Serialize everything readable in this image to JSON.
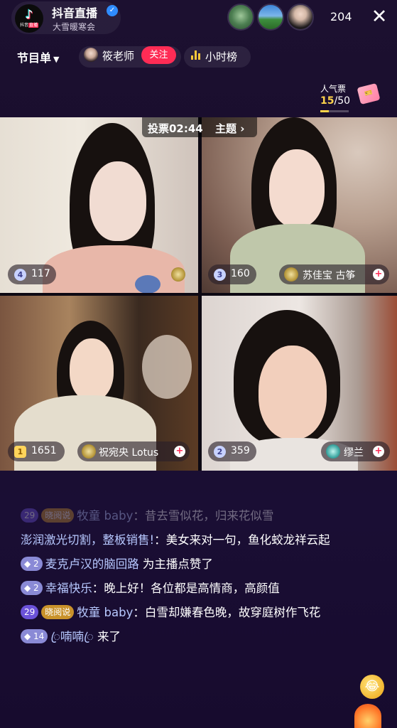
{
  "header": {
    "logo_text": "抖音",
    "logo_tag": "直播",
    "title": "抖音直播",
    "subtitle": "大雪暖寒会",
    "viewer_count": "204",
    "close_symbol": "✕"
  },
  "toolbar": {
    "program_label": "节目单",
    "teacher_name": "筱老师",
    "follow_label": "关注",
    "hourly_rank_label": "小时榜"
  },
  "popularity": {
    "label": "人气票",
    "current": "15",
    "total": "/50",
    "fraction": 0.3
  },
  "vote": {
    "timer": "投票02:44",
    "topic": "主题 ›"
  },
  "streams": [
    {
      "rank": "4",
      "score": "117",
      "name": ""
    },
    {
      "rank": "3",
      "score": "160",
      "name": "苏佳宝 古筝"
    },
    {
      "rank": "1",
      "score": "1651",
      "name": "祝宛央 Lotus"
    },
    {
      "rank": "2",
      "score": "359",
      "name": "缪兰"
    }
  ],
  "chat": [
    {
      "level": "29",
      "fan": "晓阅说",
      "user": "牧童 baby",
      "text": "：昔去雪似花，归来花似雪",
      "faded": true
    },
    {
      "user": "澎润激光切割，整板销售!",
      "text": "：美女来对一句，鱼化蛟龙祥云起"
    },
    {
      "level": "2",
      "user": "麦克卢汉的脑回路",
      "text": " 为主播点赞了"
    },
    {
      "level": "2",
      "user": "幸福快乐",
      "text": "：晚上好！各位都是高情商，高颜值"
    },
    {
      "level": "29",
      "fan": "晓阅说",
      "user": "牧童 baby",
      "text": "：白雪却嫌春色晚，故穿庭树作飞花"
    },
    {
      "level": "14",
      "user": "ꦿ喃喃ꦿ",
      "text": " 来了"
    }
  ]
}
